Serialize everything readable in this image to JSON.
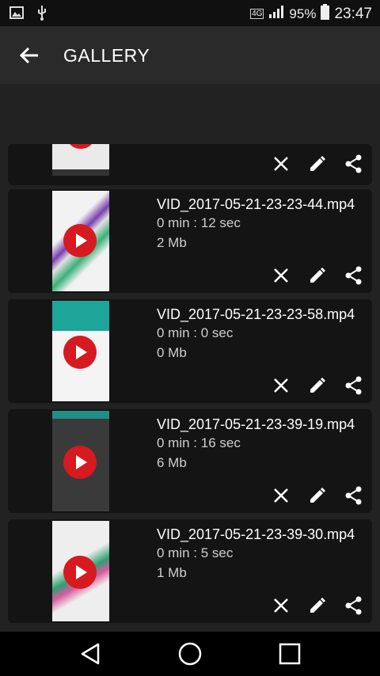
{
  "status": {
    "battery": "95%",
    "time": "23:47",
    "network": "4G"
  },
  "app_bar": {
    "title": "GALLERY"
  },
  "videos": [
    {
      "name": "VID_2017-05-21-23-23-44.mp4",
      "duration": "0 min : 12 sec",
      "size": "2 Mb"
    },
    {
      "name": "VID_2017-05-21-23-23-58.mp4",
      "duration": "0 min : 0 sec",
      "size": "0 Mb"
    },
    {
      "name": "VID_2017-05-21-23-39-19.mp4",
      "duration": "0 min : 16 sec",
      "size": "6 Mb"
    },
    {
      "name": "VID_2017-05-21-23-39-30.mp4",
      "duration": "0 min : 5 sec",
      "size": "1 Mb"
    }
  ],
  "icons": {
    "back": "arrow-back-icon",
    "delete": "close-icon",
    "edit": "pencil-icon",
    "share": "share-icon"
  },
  "colors": {
    "accent": "#d71920",
    "card": "#141414",
    "background": "#222222"
  }
}
